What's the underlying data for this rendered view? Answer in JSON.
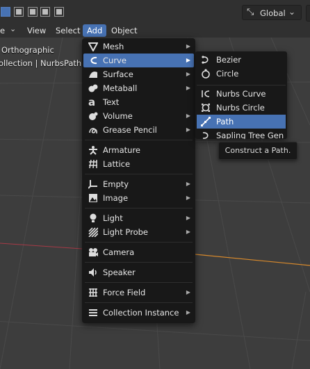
{
  "header": {
    "orientation": {
      "label": "Global",
      "icon": "transform-orientation-icon"
    },
    "menus": [
      {
        "label": "e",
        "active": false
      },
      {
        "label": "View",
        "active": false
      },
      {
        "label": "Select",
        "active": false
      },
      {
        "label": "Add",
        "active": true
      },
      {
        "label": "Object",
        "active": false
      }
    ]
  },
  "viewport": {
    "overlay_line1": "Orthographic",
    "overlay_line2": "ollection | NurbsPath"
  },
  "add_menu": {
    "items": [
      {
        "label": "Mesh",
        "icon": "mesh-icon"
      },
      {
        "label": "Curve",
        "icon": "curve-icon"
      },
      {
        "label": "Surface",
        "icon": "surface-icon"
      },
      {
        "label": "Metaball",
        "icon": "metaball-icon"
      },
      {
        "label": "Text",
        "icon": "text-icon"
      },
      {
        "label": "Volume",
        "icon": "volume-icon"
      },
      {
        "label": "Grease Pencil",
        "icon": "grease-pencil-icon"
      },
      {
        "label": "Armature",
        "icon": "armature-icon"
      },
      {
        "label": "Lattice",
        "icon": "lattice-icon"
      },
      {
        "label": "Empty",
        "icon": "empty-icon"
      },
      {
        "label": "Image",
        "icon": "image-icon"
      },
      {
        "label": "Light",
        "icon": "light-icon"
      },
      {
        "label": "Light Probe",
        "icon": "light-probe-icon"
      },
      {
        "label": "Camera",
        "icon": "camera-icon"
      },
      {
        "label": "Speaker",
        "icon": "speaker-icon"
      },
      {
        "label": "Force Field",
        "icon": "force-field-icon"
      },
      {
        "label": "Collection Instance",
        "icon": "collection-instance-icon"
      }
    ]
  },
  "curve_menu": {
    "items": [
      {
        "label": "Bezier",
        "icon": "bezier-icon"
      },
      {
        "label": "Circle",
        "icon": "curve-circle-icon"
      },
      {
        "label": "Nurbs Curve",
        "icon": "nurbs-curve-icon"
      },
      {
        "label": "Nurbs Circle",
        "icon": "nurbs-circle-icon"
      },
      {
        "label": "Path",
        "icon": "path-icon"
      },
      {
        "label": "Sapling Tree Gen",
        "icon": "sapling-tree-icon"
      }
    ],
    "highlighted": "Path"
  },
  "tooltip": {
    "text": "Construct a Path."
  },
  "colors": {
    "accent": "#4772b3",
    "x_axis": "#a83a47",
    "y_axis": "#d98a2c",
    "grid": "#4a4a4a",
    "background": "#3d3d3d"
  }
}
